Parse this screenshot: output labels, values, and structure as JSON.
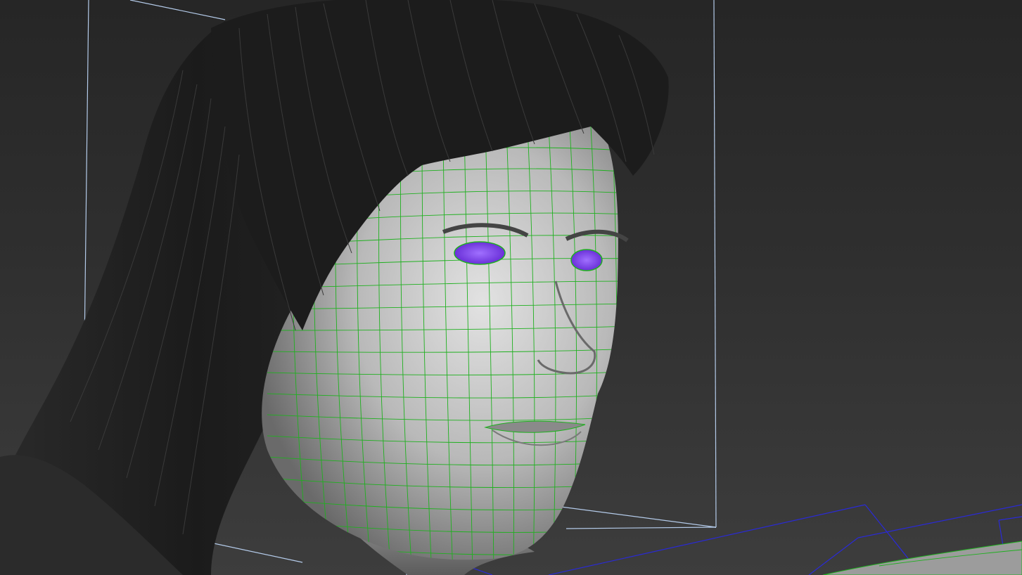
{
  "viewport": {
    "background_top": "#262626",
    "background_bottom": "#3d3d3d"
  },
  "scene": {
    "hair_color": "#1e1e1e",
    "hair_strand_color": "#3a3a3a",
    "skin_light": "#d8d8d8",
    "skin_dark": "#6e6e6e",
    "wireframe_color": "#1fb01f",
    "eye_color": "#8a4df0",
    "bounding_box_color": "#b4cbea",
    "grid_line_color": "#2a2ad6"
  }
}
